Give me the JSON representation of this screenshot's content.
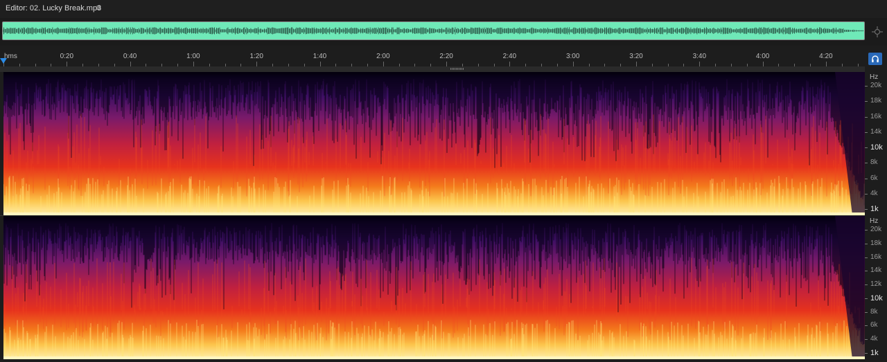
{
  "editor": {
    "title": "Editor: 02. Lucky Break.mp3",
    "menu_icon": "hamburger-menu-icon"
  },
  "overview": {
    "waveform_color": "#6fe9b8",
    "zoom_icon": "zoom-navigator-icon"
  },
  "timeline": {
    "unit_label": "hms",
    "labels": [
      "0:20",
      "0:40",
      "1:00",
      "1:20",
      "1:40",
      "2:00",
      "2:20",
      "2:40",
      "3:00",
      "3:20",
      "3:40",
      "4:00",
      "4:20"
    ],
    "playhead_color": "#2b8be6",
    "monitor_icon": "headphones-icon"
  },
  "spectral": {
    "colormap": [
      "#000000",
      "#2a0a4a",
      "#6b1373",
      "#b21e50",
      "#e8311f",
      "#f7851a",
      "#fde06a",
      "#fff7c2"
    ],
    "channels": [
      {
        "unit": "Hz",
        "ticks": [
          {
            "label": "20k",
            "major": false
          },
          {
            "label": "18k",
            "major": false
          },
          {
            "label": "16k",
            "major": false
          },
          {
            "label": "14k",
            "major": false
          },
          {
            "label": "10k",
            "major": true
          },
          {
            "label": "8k",
            "major": false
          },
          {
            "label": "6k",
            "major": false
          },
          {
            "label": "4k",
            "major": false
          },
          {
            "label": "1k",
            "major": true
          }
        ]
      },
      {
        "unit": "Hz",
        "ticks": [
          {
            "label": "20k",
            "major": false
          },
          {
            "label": "18k",
            "major": false
          },
          {
            "label": "16k",
            "major": false
          },
          {
            "label": "14k",
            "major": false
          },
          {
            "label": "12k",
            "major": false
          },
          {
            "label": "10k",
            "major": true
          },
          {
            "label": "8k",
            "major": false
          },
          {
            "label": "6k",
            "major": false
          },
          {
            "label": "4k",
            "major": false
          },
          {
            "label": "1k",
            "major": true
          }
        ]
      }
    ]
  }
}
